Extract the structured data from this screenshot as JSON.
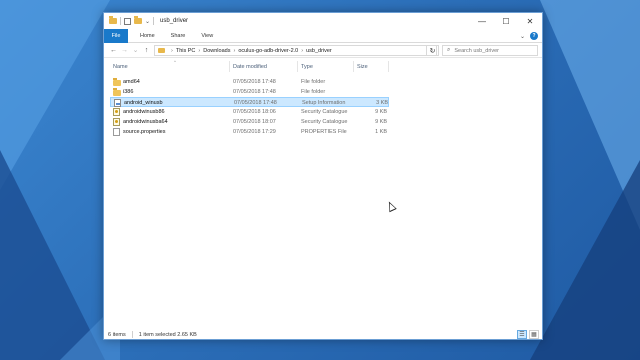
{
  "window": {
    "title": "usb_driver",
    "controls": {
      "minimize": "—",
      "maximize": "☐",
      "close": "✕"
    }
  },
  "ribbon": {
    "tabs": [
      "File",
      "Home",
      "Share",
      "View"
    ],
    "expand_glyph": "⌄",
    "help_glyph": "?"
  },
  "nav": {
    "back_glyph": "←",
    "forward_glyph": "→",
    "recent_glyph": "⌄",
    "up_glyph": "↑",
    "breadcrumbs": [
      "This PC",
      "Downloads",
      "oculus-go-adb-driver-2.0",
      "usb_driver"
    ],
    "crumb_separator": "›",
    "dropdown_glyph": "⌄",
    "refresh_glyph": "↻",
    "search_placeholder": "Search usb_driver",
    "search_icon": "⌕"
  },
  "columns": {
    "name": "Name",
    "date": "Date modified",
    "type": "Type",
    "size": "Size",
    "sort_glyph": "^"
  },
  "files": [
    {
      "icon": "folder",
      "name": "amd64",
      "date": "07/05/2018 17:48",
      "type": "File folder",
      "size": ""
    },
    {
      "icon": "folder",
      "name": "i386",
      "date": "07/05/2018 17:48",
      "type": "File folder",
      "size": ""
    },
    {
      "icon": "inf",
      "name": "android_winusb",
      "date": "07/05/2018 17:48",
      "type": "Setup Information",
      "size": "3 KB"
    },
    {
      "icon": "catalog",
      "name": "androidwinusb86",
      "date": "07/05/2018 18:06",
      "type": "Security Catalogue",
      "size": "9 KB"
    },
    {
      "icon": "catalog",
      "name": "androidwinusba64",
      "date": "07/05/2018 18:07",
      "type": "Security Catalogue",
      "size": "9 KB"
    },
    {
      "icon": "file",
      "name": "source.properties",
      "date": "07/05/2018 17:29",
      "type": "PROPERTIES File",
      "size": "1 KB"
    }
  ],
  "selected_index": 2,
  "status": {
    "count": "6 items",
    "selection": "1 item selected  2.65 KB"
  },
  "view_buttons": {
    "details": "☰",
    "large_icons": "▦"
  },
  "colors": {
    "accent": "#1979ca",
    "selection": "#cce8ff",
    "folder": "#f0c55a"
  }
}
